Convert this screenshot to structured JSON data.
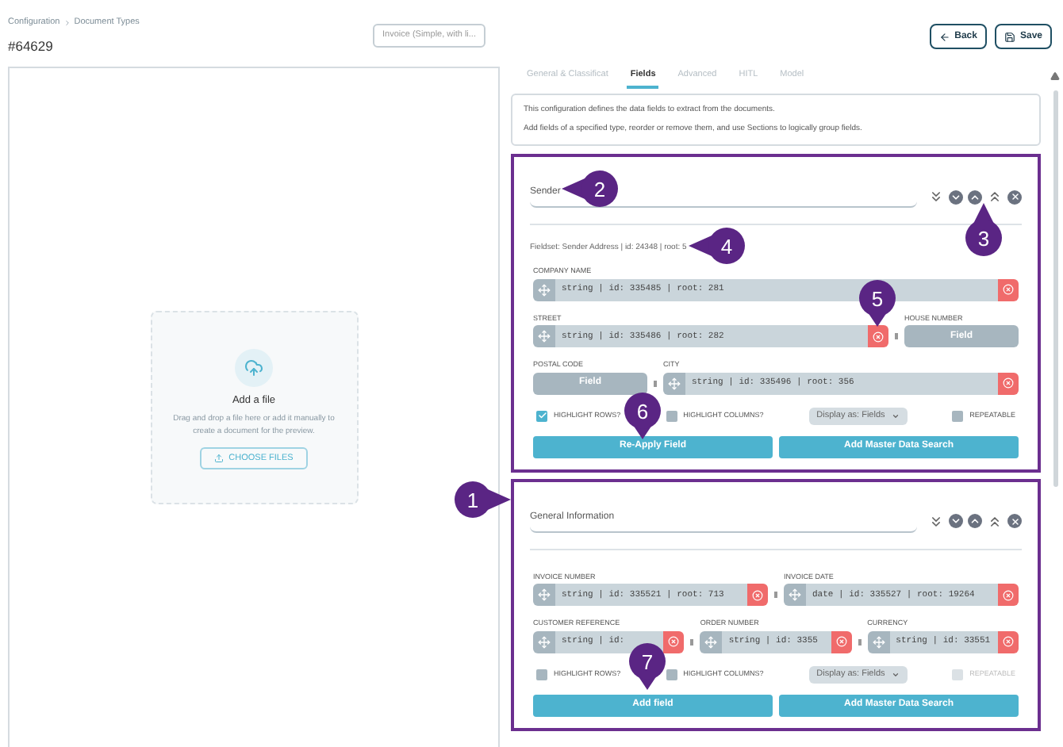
{
  "breadcrumb": [
    "Configuration",
    "Document Types"
  ],
  "title": "#64629",
  "document_select": {
    "value": "Invoice (Simple, with li..."
  },
  "buttons": [
    {
      "label": "Back",
      "kind": "back"
    },
    {
      "label": "Save",
      "kind": "save"
    }
  ],
  "upload": {
    "title": "Add a file",
    "description": "Drag and drop a file here or add it manually to create a document for the preview.",
    "button": "CHOOSE FILES"
  },
  "tabs": [
    {
      "label": "General & Classificat",
      "selected": false
    },
    {
      "label": "Fields",
      "selected": true
    },
    {
      "label": "Advanced",
      "selected": false
    },
    {
      "label": "HITL",
      "selected": false
    },
    {
      "label": "Model",
      "selected": false
    }
  ],
  "info": [
    "This configuration defines the data fields to extract from the documents.",
    "Add fields of a specified type, reorder or remove them, and use Sections to logically group fields."
  ],
  "sections": [
    {
      "name": "Sender",
      "fieldset": "Fieldset: Sender Address | id: 24348 | root: 5",
      "rows": [
        [
          {
            "kind": "field",
            "label": "COMPANY NAME",
            "value": "string | id: 335485 | root: 281"
          }
        ],
        [
          {
            "kind": "field",
            "label": "STREET",
            "value": "string | id: 335486 | root: 282"
          },
          {
            "kind": "placeholder",
            "label": "HOUSE NUMBER",
            "value": "Field"
          }
        ],
        [
          {
            "kind": "placeholder",
            "label": "POSTAL CODE",
            "value": "Field"
          },
          {
            "kind": "field",
            "label": "CITY",
            "value": "string | id: 335496 | root: 356"
          }
        ]
      ],
      "options": [
        {
          "kind": "checkbox",
          "label": "HIGHLIGHT ROWS?",
          "checked": true,
          "disabled": false
        },
        {
          "kind": "checkbox",
          "label": "HIGHLIGHT COLUMNS?",
          "checked": false,
          "disabled": false
        },
        {
          "kind": "select",
          "label": "Display as: Fields"
        },
        {
          "kind": "checkbox",
          "label": "REPEATABLE",
          "checked": false,
          "disabled": false
        }
      ],
      "actions": [
        "Re-Apply Field",
        "Add Master Data Search"
      ]
    },
    {
      "name": "General Information",
      "rows": [
        [
          {
            "kind": "field",
            "label": "INVOICE NUMBER",
            "value": "string | id: 335521 | root: 713"
          },
          {
            "kind": "field",
            "label": "INVOICE DATE",
            "value": "date | id: 335527 | root: 19264"
          }
        ],
        [
          {
            "kind": "field",
            "label": "CUSTOMER REFERENCE",
            "value": "string | id:"
          },
          {
            "kind": "field",
            "label": "ORDER NUMBER",
            "value": "string | id: 3355"
          },
          {
            "kind": "field",
            "label": "CURRENCY",
            "value": "string | id: 33551"
          }
        ]
      ],
      "options": [
        {
          "kind": "checkbox",
          "label": "HIGHLIGHT ROWS?",
          "checked": false,
          "disabled": false
        },
        {
          "kind": "checkbox",
          "label": "HIGHLIGHT COLUMNS?",
          "checked": false,
          "disabled": false
        },
        {
          "kind": "select",
          "label": "Display as: Fields"
        },
        {
          "kind": "checkbox",
          "label": "REPEATABLE",
          "checked": false,
          "disabled": true
        }
      ],
      "actions": [
        "Add field",
        "Add Master Data Search"
      ]
    }
  ],
  "callouts": [
    {
      "number": "1"
    },
    {
      "number": "2"
    },
    {
      "number": "3"
    },
    {
      "number": "4"
    },
    {
      "number": "5"
    },
    {
      "number": "6"
    },
    {
      "number": "7"
    }
  ]
}
